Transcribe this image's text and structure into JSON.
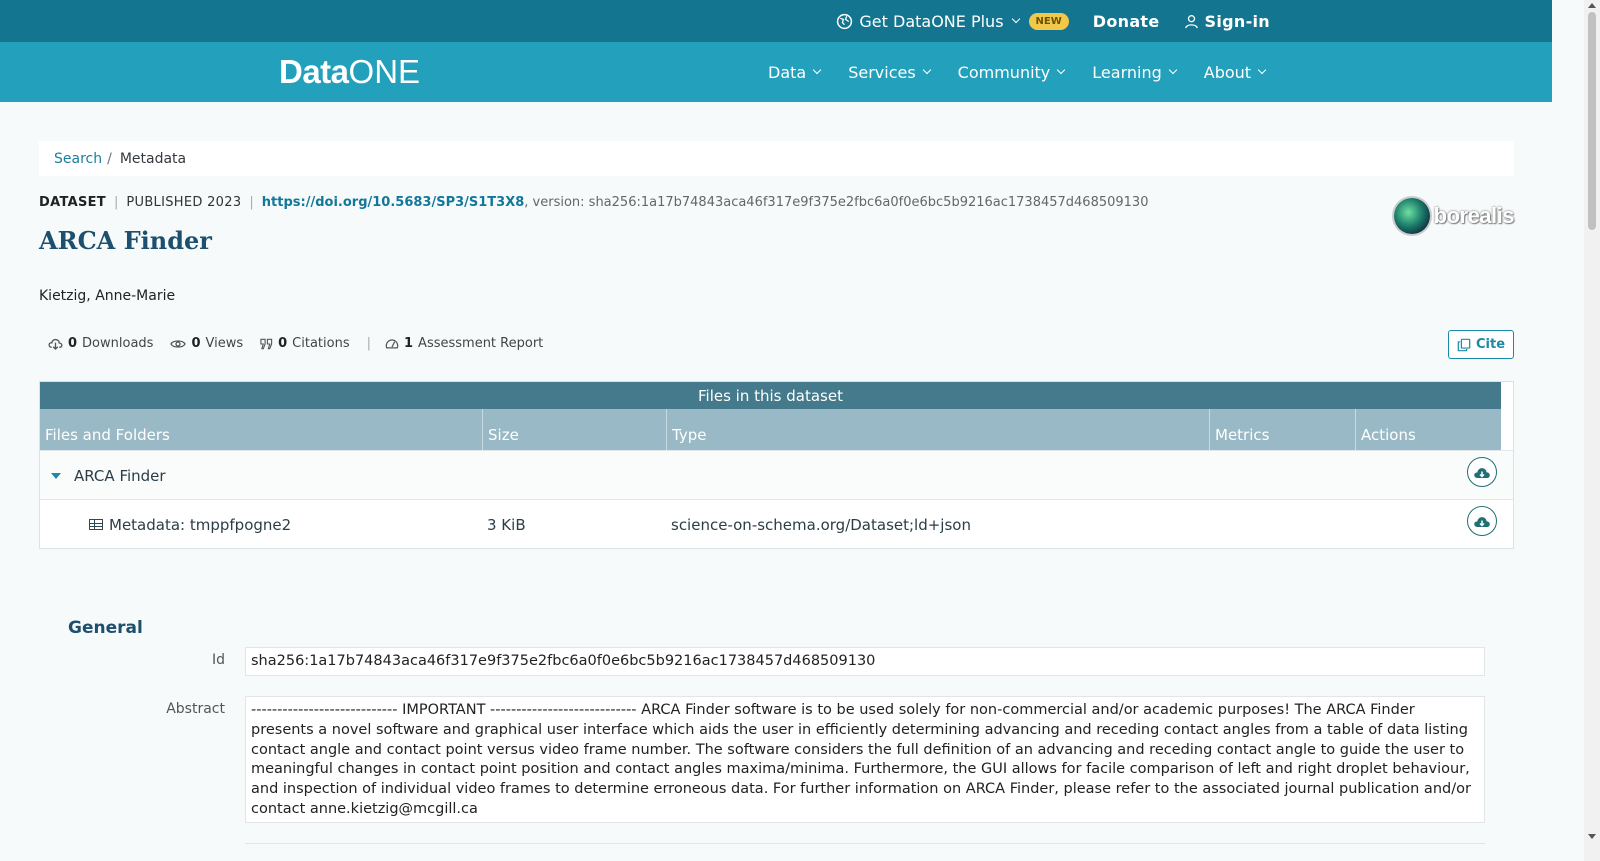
{
  "topbar": {
    "plus_label": "Get DataONE Plus",
    "new_badge": "NEW",
    "donate_label": "Donate",
    "signin_label": "Sign-in"
  },
  "nav": {
    "logo_data": "Data",
    "logo_one": "ONE",
    "items": [
      "Data",
      "Services",
      "Community",
      "Learning",
      "About"
    ]
  },
  "breadcrumb": {
    "search": "Search",
    "separator": "/",
    "current": "Metadata"
  },
  "dataset": {
    "type": "DATASET",
    "published": "PUBLISHED 2023",
    "doi": "https://doi.org/10.5683/SP3/S1T3X8",
    "version": ", version: sha256:1a17b74843aca46f317e9f375e2fbc6a0f0e6bc5b9216ac1738457d468509130",
    "title": "ARCA Finder",
    "author": "Kietzig, Anne-Marie",
    "repository": "borealis"
  },
  "stats": {
    "downloads_count": "0",
    "downloads_label": "Downloads",
    "views_count": "0",
    "views_label": "Views",
    "citations_count": "0",
    "citations_label": "Citations",
    "assessment_count": "1",
    "assessment_label": "Assessment Report",
    "cite_label": "Cite"
  },
  "files": {
    "header": "Files in this dataset",
    "columns": [
      "Files and Folders",
      "Size",
      "Type",
      "Metrics",
      "Actions"
    ],
    "folder_name": "ARCA Finder",
    "rows": [
      {
        "name": "Metadata: tmppfpogne2",
        "size": "3 KiB",
        "type": "science-on-schema.org/Dataset;ld+json"
      }
    ]
  },
  "general": {
    "title": "General",
    "id_label": "Id",
    "id_value": "sha256:1a17b74843aca46f317e9f375e2fbc6a0f0e6bc5b9216ac1738457d468509130",
    "abstract_label": "Abstract",
    "abstract_value": "---------------------------- IMPORTANT ---------------------------- ARCA Finder software is to be used solely for non-commercial and/or academic purposes! The ARCA Finder presents a novel software and graphical user interface which aids the user in efficiently determining advancing and receding contact angles from a table of data listing contact angle and contact point versus video frame number. The software considers the full definition of an advancing and receding contact angle to guide the user to meaningful changes in contact point position and contact angles maxima/minima. Furthermore, the GUI allows for facile comparison of left and right droplet behaviour, and inspection of individual video frames to determine erroneous data. For further information on ARCA Finder, please refer to the associated journal publication and/or contact anne.kietzig@mcgill.ca"
  },
  "colors": {
    "topbar": "#13758f",
    "mainnav": "#23a0bc",
    "table_header": "#447a8c",
    "table_cols": "#9ab9c6",
    "accent": "#1a8aa8"
  }
}
